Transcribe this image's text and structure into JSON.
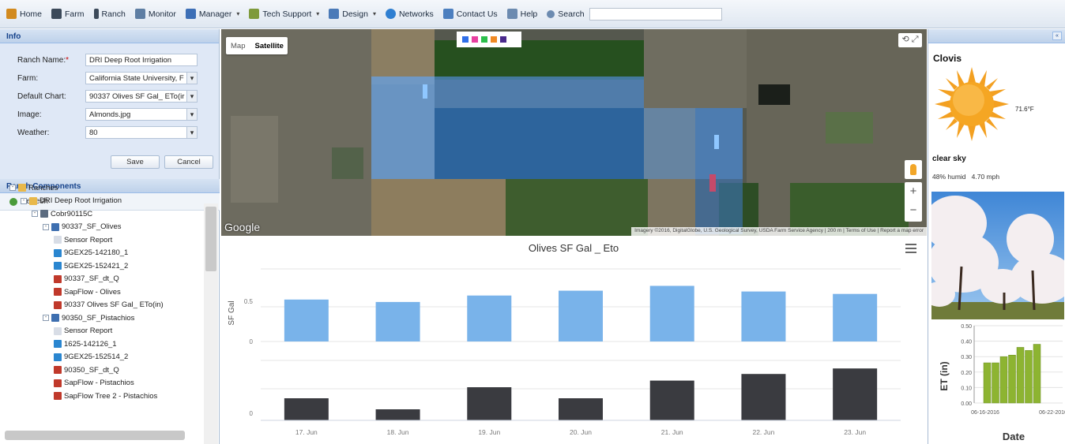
{
  "nav": {
    "items": [
      {
        "label": "Home",
        "icon": "home-icon",
        "color": "#d28a1e"
      },
      {
        "label": "Farm",
        "icon": "farm-icon",
        "color": "#3c4a5a"
      },
      {
        "label": "Ranch",
        "icon": "ranch-icon",
        "color": "#3c4a5a"
      },
      {
        "label": "Monitor",
        "icon": "monitor-icon",
        "color": "#5e7ea3"
      },
      {
        "label": "Manager",
        "icon": "manager-icon",
        "color": "#3d6fb6",
        "dropdown": true
      },
      {
        "label": "Tech Support",
        "icon": "tech-support-icon",
        "color": "#7e9a3b",
        "dropdown": true
      },
      {
        "label": "Design",
        "icon": "design-icon",
        "color": "#4a7ab8",
        "dropdown": true
      },
      {
        "label": "Networks",
        "icon": "networks-icon",
        "color": "#2f7fd1"
      },
      {
        "label": "Contact Us",
        "icon": "contact-icon",
        "color": "#4c7fbf"
      },
      {
        "label": "Help",
        "icon": "help-icon",
        "color": "#6c8bb0"
      },
      {
        "label": "Search",
        "icon": "search-icon",
        "color": "#6c8bb0"
      }
    ]
  },
  "info": {
    "title": "Info",
    "ranch_name_label": "Ranch Name:",
    "ranch_name_req": "*",
    "ranch_name_value": "DRI Deep Root Irrigation",
    "farm_label": "Farm:",
    "farm_value": "California State University, F",
    "default_chart_label": "Default Chart:",
    "default_chart_value": "90337 Olives SF Gal_ ETo(ir",
    "image_label": "Image:",
    "image_value": "Almonds.jpg",
    "weather_label": "Weather:",
    "weather_value": "80",
    "save_label": "Save",
    "cancel_label": "Cancel"
  },
  "components": {
    "title": "Ranch Components",
    "refresh_label": "Refresh",
    "tree": [
      {
        "label": "Ranches",
        "level": 0,
        "icon": "folder-icon",
        "expander": "-"
      },
      {
        "label": "DRI Deep Root Irrigation",
        "level": 1,
        "icon": "folder-icon",
        "expander": "-"
      },
      {
        "label": "Cobr90115C",
        "level": 2,
        "icon": "gateway-icon",
        "expander": "-"
      },
      {
        "label": "90337_SF_Olives",
        "level": 3,
        "icon": "device-icon",
        "expander": "-"
      },
      {
        "label": "Sensor Report",
        "level": 4,
        "icon": "report-icon"
      },
      {
        "label": "9GEX25-142180_1",
        "level": 4,
        "icon": "sensor-icon"
      },
      {
        "label": "5GEX25-152421_2",
        "level": 4,
        "icon": "sensor-icon"
      },
      {
        "label": "90337_SF_dt_Q",
        "level": 4,
        "icon": "chart-line-icon"
      },
      {
        "label": "SapFlow - Olives",
        "level": 4,
        "icon": "chart-line-icon"
      },
      {
        "label": "90337 Olives SF Gal_ ETo(in)",
        "level": 4,
        "icon": "chart-line-icon"
      },
      {
        "label": "90350_SF_Pistachios",
        "level": 3,
        "icon": "device-icon",
        "expander": "-"
      },
      {
        "label": "Sensor Report",
        "level": 4,
        "icon": "report-icon"
      },
      {
        "label": "1625-142126_1",
        "level": 4,
        "icon": "sensor-icon"
      },
      {
        "label": "9GEX25-152514_2",
        "level": 4,
        "icon": "sensor-icon"
      },
      {
        "label": "90350_SF_dt_Q",
        "level": 4,
        "icon": "chart-line-icon"
      },
      {
        "label": "SapFlow - Pistachios",
        "level": 4,
        "icon": "chart-line-icon"
      },
      {
        "label": "SapFlow Tree 2 - Pistachios",
        "level": 4,
        "icon": "chart-line-icon"
      }
    ]
  },
  "map": {
    "map_label": "Map",
    "satellite_label": "Satellite",
    "logo": "Google",
    "attribution": "Imagery ©2016, DigitalGlobe, U.S. Geological Survey, USDA Farm Service Agency | 200 m | Terms of Use | Report a map error",
    "palette": [
      "#2f6fe8",
      "#e83fa0",
      "#2bbf4b",
      "#f08a24",
      "#4a2a8c"
    ]
  },
  "chart_data": {
    "type": "bar",
    "title": "Olives SF Gal _ Eto",
    "categories": [
      "17. Jun",
      "18. Jun",
      "19. Jun",
      "20. Jun",
      "21. Jun",
      "22. Jun",
      "23. Jun"
    ],
    "series": [
      {
        "values": [
          0.52,
          0.49,
          0.57,
          0.63,
          0.69,
          0.62,
          0.59
        ],
        "color": "#79b3ea"
      },
      {
        "values": [
          0.2,
          0.1,
          0.3,
          0.2,
          0.36,
          0.42,
          0.47
        ],
        "color": "#3a3b40"
      }
    ],
    "ylabel_top": "SF Gal",
    "yticks_top": [
      "0.5",
      "0"
    ],
    "yticks_bottom": [
      "0"
    ],
    "ylim_top": [
      0,
      0.9
    ],
    "ylim_bottom": [
      0,
      0.6
    ],
    "menu_icon": "hamburger-menu-icon"
  },
  "weather": {
    "city": "Clovis",
    "temperature": "71.6°F",
    "condition": "clear sky",
    "humidity": "48% humid",
    "wind": "4.70 mph",
    "icon": "sun-icon",
    "image_caption": "Almond trees in bloom"
  },
  "et_chart": {
    "ylabel": "ET (in)",
    "xlabel": "Date",
    "yticks": [
      "0.50",
      "0.40",
      "0.30",
      "0.20",
      "0.10",
      "0.00"
    ],
    "xticks": [
      "06-16-2016",
      "06-22-2016"
    ],
    "values": [
      0.26,
      0.26,
      0.3,
      0.31,
      0.36,
      0.34,
      0.38
    ],
    "color": "#8db431",
    "ylim": [
      0,
      0.5
    ]
  }
}
